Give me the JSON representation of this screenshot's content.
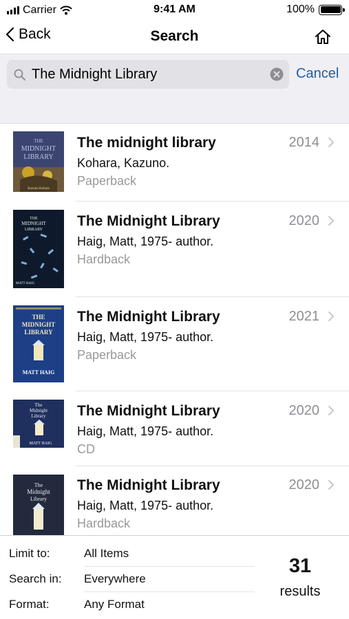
{
  "status_bar": {
    "carrier": "Carrier",
    "time": "9:41 AM",
    "battery": "100%"
  },
  "nav": {
    "back_label": "Back",
    "title": "Search"
  },
  "search": {
    "query": "The Midnight Library",
    "cancel_label": "Cancel"
  },
  "results": [
    {
      "title": "The midnight library",
      "author": "Kohara, Kazuno.",
      "format": "Paperback",
      "year": "2014",
      "cover": {
        "title_lines": [
          "THE",
          "MIDNIGHT",
          "LIBRARY"
        ],
        "author": "Kazuno Kohara"
      }
    },
    {
      "title": "The Midnight Library",
      "author": "Haig, Matt, 1975- author.",
      "format": "Hardback",
      "year": "2020",
      "cover": {
        "title_lines": [
          "THE",
          "MIDNIGHT",
          "LIBRARY"
        ],
        "author": "MATT HAIG"
      }
    },
    {
      "title": "The Midnight Library",
      "author": "Haig, Matt, 1975- author.",
      "format": "Paperback",
      "year": "2021",
      "cover": {
        "title_lines": [
          "THE",
          "MIDNIGHT",
          "LIBRARY"
        ],
        "author": "MATT HAIG"
      }
    },
    {
      "title": "The Midnight Library",
      "author": "Haig, Matt, 1975- author.",
      "format": "CD",
      "year": "2020",
      "cover": {
        "title_lines": [
          "The",
          "Midnight",
          "Library"
        ],
        "author": "MATT HAIG"
      }
    },
    {
      "title": "The Midnight Library",
      "author": "Haig, Matt, 1975- author.",
      "format": "Hardback",
      "year": "2020",
      "cover": {
        "title_lines": [
          "The",
          "Midnight",
          "Library"
        ],
        "author": ""
      }
    }
  ],
  "filters": [
    {
      "label": "Limit to:",
      "value": "All Items"
    },
    {
      "label": "Search in:",
      "value": "Everywhere"
    },
    {
      "label": "Format:",
      "value": "Any Format"
    }
  ],
  "count": {
    "number": "31",
    "label": "results"
  },
  "icons": {
    "back": "chevron-left-icon",
    "home": "home-icon",
    "search": "magnifier-icon",
    "clear": "clear-circle-icon",
    "row_chevron": "chevron-right-icon"
  },
  "colors": {
    "accent": "#1f5f9a",
    "search_bg": "#efeff4",
    "muted_text": "#999999"
  }
}
